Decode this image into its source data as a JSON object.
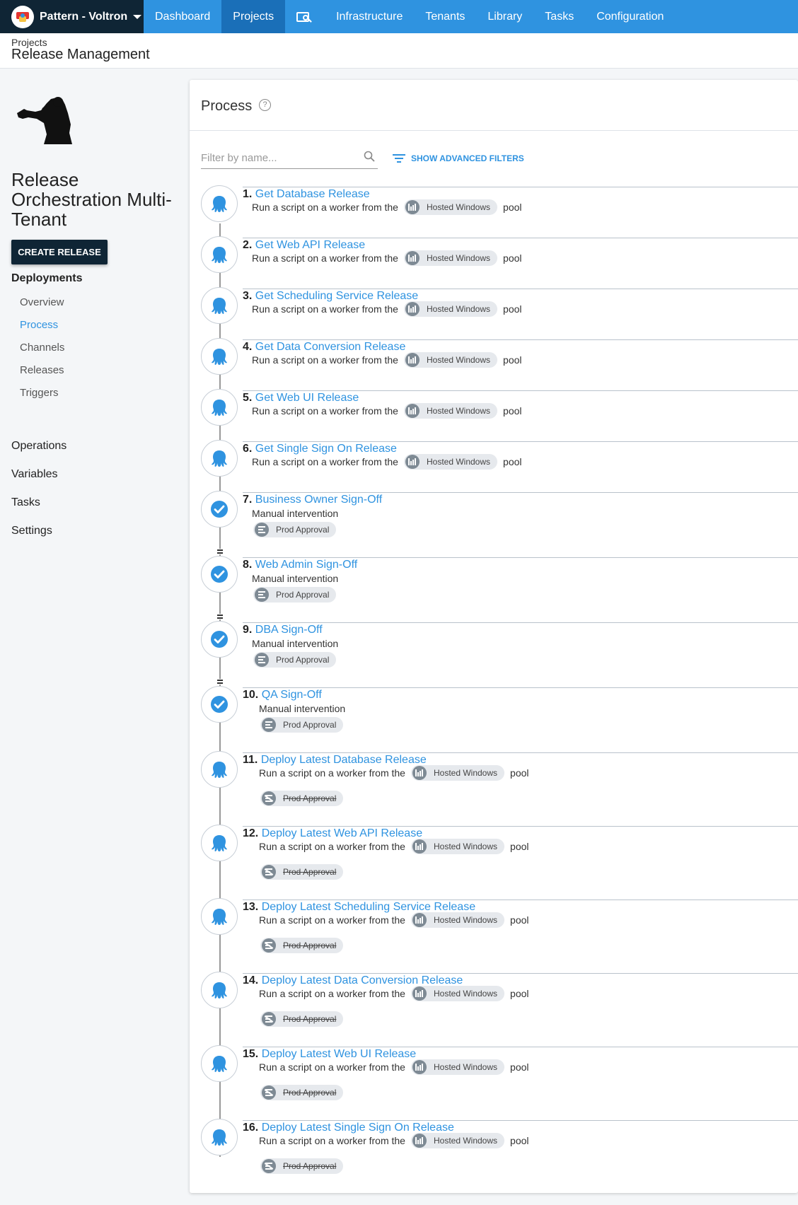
{
  "nav": {
    "space_name": "Pattern - Voltron",
    "items": [
      {
        "label": "Dashboard",
        "active": false
      },
      {
        "label": "Projects",
        "active": true
      },
      {
        "label": "Infrastructure",
        "active": false
      },
      {
        "label": "Tenants",
        "active": false
      },
      {
        "label": "Library",
        "active": false
      },
      {
        "label": "Tasks",
        "active": false
      },
      {
        "label": "Configuration",
        "active": false
      }
    ],
    "search_icon": "search-icon"
  },
  "breadcrumb": {
    "parent": "Projects",
    "title": "Release Management"
  },
  "sidebar": {
    "project_name": "Release Orchestration Multi-Tenant",
    "create_release_label": "CREATE RELEASE",
    "deployments_heading": "Deployments",
    "deployments_items": [
      "Overview",
      "Process",
      "Channels",
      "Releases",
      "Triggers"
    ],
    "active_item": "Process",
    "sections": [
      "Operations",
      "Variables",
      "Tasks",
      "Settings"
    ]
  },
  "process": {
    "title": "Process",
    "filter_placeholder": "Filter by name...",
    "advanced_filters_label": "SHOW ADVANCED FILTERS",
    "worker_prefix": "Run a script on a worker from the",
    "worker_pool": "Hosted Windows",
    "worker_suffix": "pool",
    "manual_intervention": "Manual intervention",
    "steps": [
      {
        "num": "1.",
        "name": "Get Database Release",
        "kind": "script"
      },
      {
        "num": "2.",
        "name": "Get Web API Release",
        "kind": "script"
      },
      {
        "num": "3.",
        "name": "Get Scheduling Service Release",
        "kind": "script"
      },
      {
        "num": "4.",
        "name": "Get Data Conversion Release",
        "kind": "script"
      },
      {
        "num": "5.",
        "name": "Get Web UI Release",
        "kind": "script"
      },
      {
        "num": "6.",
        "name": "Get Single Sign On Release",
        "kind": "script"
      },
      {
        "num": "7.",
        "name": "Business Owner Sign-Off",
        "kind": "manual",
        "tag": "Prod Approval"
      },
      {
        "num": "8.",
        "name": "Web Admin Sign-Off",
        "kind": "manual",
        "tag": "Prod Approval"
      },
      {
        "num": "9.",
        "name": "DBA Sign-Off",
        "kind": "manual",
        "tag": "Prod Approval"
      },
      {
        "num": "10.",
        "name": "QA Sign-Off",
        "kind": "manual",
        "tag": "Prod Approval"
      },
      {
        "num": "11.",
        "name": "Deploy Latest Database Release",
        "kind": "script-excluded",
        "tag": "Prod Approval"
      },
      {
        "num": "12.",
        "name": "Deploy Latest Web API Release",
        "kind": "script-excluded",
        "tag": "Prod Approval"
      },
      {
        "num": "13.",
        "name": "Deploy Latest Scheduling Service Release",
        "kind": "script-excluded",
        "tag": "Prod Approval"
      },
      {
        "num": "14.",
        "name": "Deploy Latest Data Conversion Release",
        "kind": "script-excluded",
        "tag": "Prod Approval"
      },
      {
        "num": "15.",
        "name": "Deploy Latest Web UI Release",
        "kind": "script-excluded",
        "tag": "Prod Approval"
      },
      {
        "num": "16.",
        "name": "Deploy Latest Single Sign On Release",
        "kind": "script-excluded",
        "tag": "Prod Approval"
      }
    ]
  },
  "colors": {
    "accent": "#2f93e0",
    "nav_dark": "#0f2535",
    "nav_active": "#1a6fb8"
  }
}
